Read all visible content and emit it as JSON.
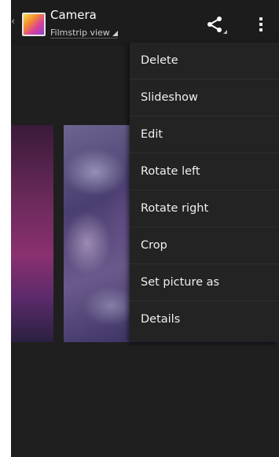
{
  "actionbar": {
    "title": "Camera",
    "subtitle": "Filmstrip view"
  },
  "icons": {
    "up": "chevron-left-icon",
    "app": "gallery-icon",
    "share": "share-icon",
    "overflow": "overflow-menu-icon"
  },
  "menu": {
    "items": [
      {
        "label": "Delete"
      },
      {
        "label": "Slideshow"
      },
      {
        "label": "Edit"
      },
      {
        "label": "Rotate left"
      },
      {
        "label": "Rotate right"
      },
      {
        "label": "Crop"
      },
      {
        "label": "Set picture as"
      },
      {
        "label": "Details"
      }
    ]
  }
}
